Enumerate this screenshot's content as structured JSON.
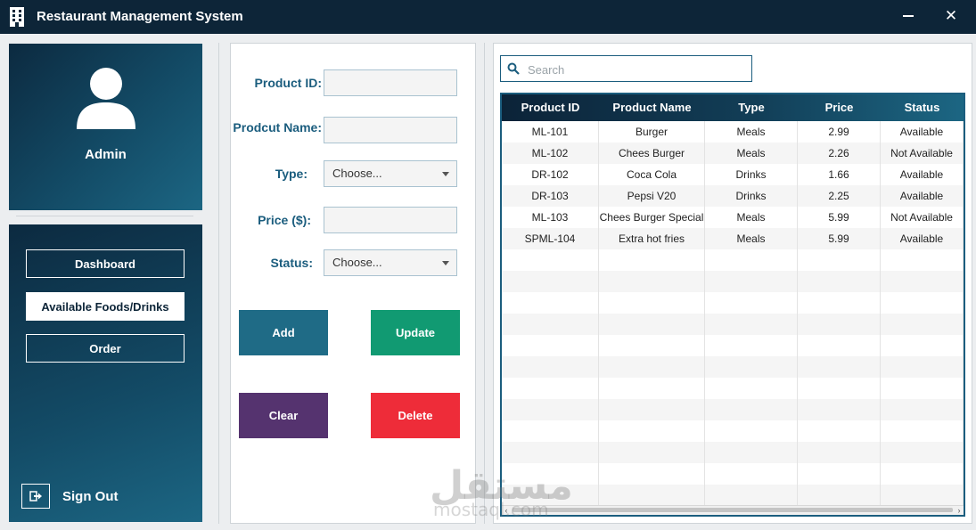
{
  "window": {
    "title": "Restaurant Management System",
    "close_glyph": "✕"
  },
  "sidebar": {
    "user_name": "Admin",
    "nav_items": [
      {
        "label": "Dashboard",
        "active": false
      },
      {
        "label": "Available Foods/Drinks",
        "active": true
      },
      {
        "label": "Order",
        "active": false
      }
    ],
    "sign_out_label": "Sign Out"
  },
  "form": {
    "product_id_label": "Product ID:",
    "product_id_value": "",
    "product_name_label": "Prodcut Name:",
    "product_name_value": "",
    "type_label": "Type:",
    "type_value": "Choose...",
    "price_label": "Price ($):",
    "price_value": "",
    "status_label": "Status:",
    "status_value": "Choose...",
    "buttons": {
      "add": "Add",
      "update": "Update",
      "clear": "Clear",
      "delete": "Delete"
    }
  },
  "search": {
    "placeholder": "Search",
    "value": ""
  },
  "table": {
    "columns": [
      "Product ID",
      "Product Name",
      "Type",
      "Price",
      "Status"
    ],
    "rows": [
      [
        "ML-101",
        "Burger",
        "Meals",
        "2.99",
        "Available"
      ],
      [
        "ML-102",
        "Chees Burger",
        "Meals",
        "2.26",
        "Not Available"
      ],
      [
        "DR-102",
        "Coca Cola",
        "Drinks",
        "1.66",
        "Available"
      ],
      [
        "DR-103",
        "Pepsi V20",
        "Drinks",
        "2.25",
        "Available"
      ],
      [
        "ML-103",
        "Chees Burger Special",
        "Meals",
        "5.99",
        "Not Available"
      ],
      [
        "SPML-104",
        "Extra hot fries",
        "Meals",
        "5.99",
        "Available"
      ]
    ]
  },
  "watermark": {
    "arabic": "مستقل",
    "latin": "mostaql.com"
  },
  "colors": {
    "brand_dark": "#0d2538",
    "accent": "#1b5d7e",
    "add": "#1f6b86",
    "update": "#119a72",
    "clear": "#55336f",
    "delete": "#ee2c39"
  },
  "icons": {
    "app": "building-icon",
    "avatar": "user-icon",
    "sign_out": "sign-out-icon",
    "search": "search-icon",
    "select_caret": "chevron-down-icon"
  }
}
